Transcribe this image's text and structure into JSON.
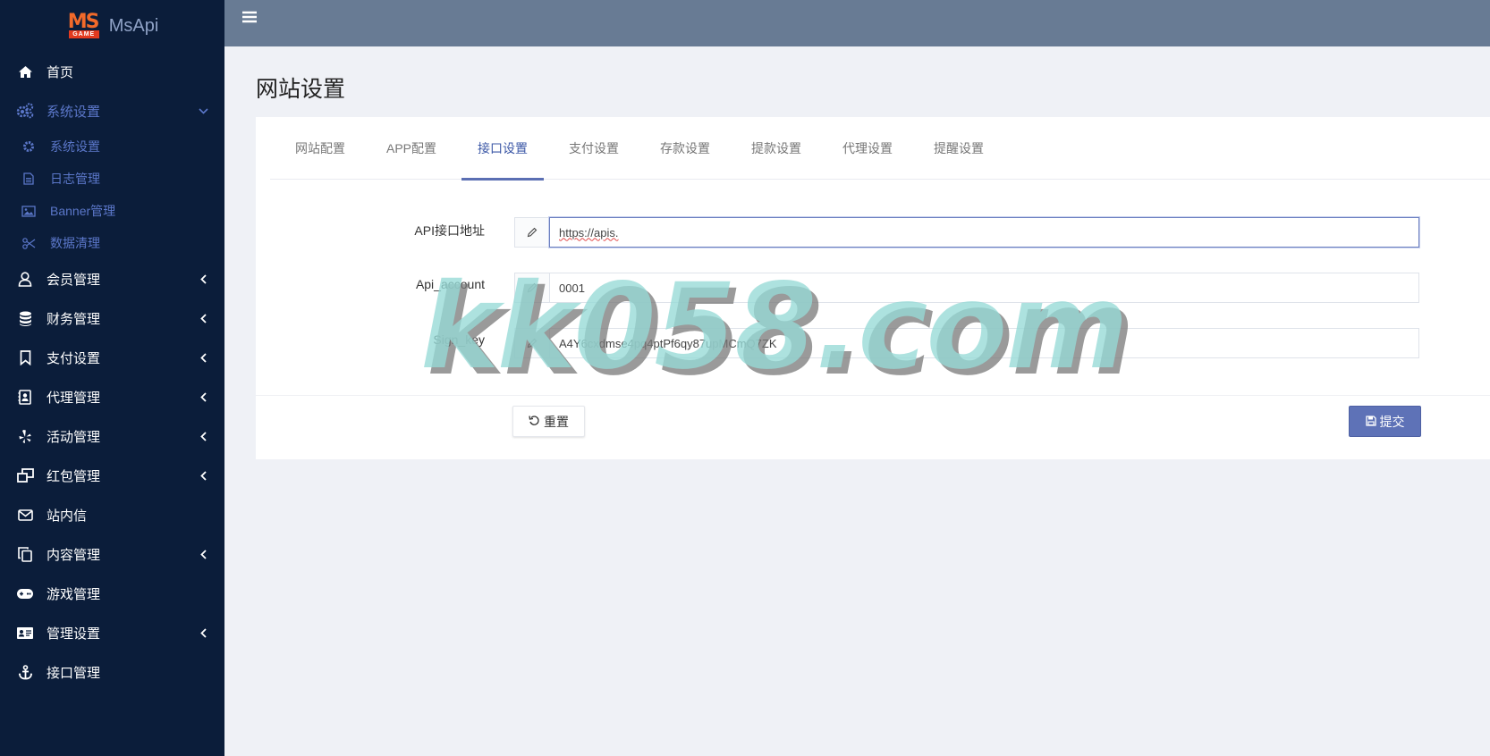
{
  "brand": {
    "logo_text": "MS",
    "logo_sub": "GAME",
    "name": "MsApi"
  },
  "sidebar": {
    "items": [
      {
        "label": "首页",
        "icon": "home-icon"
      },
      {
        "label": "系统设置",
        "icon": "cogs-icon",
        "expanded": true
      },
      {
        "label": "会员管理",
        "icon": "user-icon"
      },
      {
        "label": "财务管理",
        "icon": "database-icon"
      },
      {
        "label": "支付设置",
        "icon": "bookmark-icon"
      },
      {
        "label": "代理管理",
        "icon": "address-book-icon"
      },
      {
        "label": "活动管理",
        "icon": "yelp-icon"
      },
      {
        "label": "红包管理",
        "icon": "window-restore-icon"
      },
      {
        "label": "站内信",
        "icon": "envelope-icon"
      },
      {
        "label": "内容管理",
        "icon": "copy-icon"
      },
      {
        "label": "游戏管理",
        "icon": "gamepad-icon"
      },
      {
        "label": "管理设置",
        "icon": "id-card-icon"
      },
      {
        "label": "接口管理",
        "icon": "anchor-icon"
      }
    ],
    "sub_items": [
      {
        "label": "系统设置",
        "icon": "gear-icon"
      },
      {
        "label": "日志管理",
        "icon": "file-text-icon"
      },
      {
        "label": "Banner管理",
        "icon": "image-icon"
      },
      {
        "label": "数据清理",
        "icon": "scissors-icon"
      }
    ]
  },
  "page": {
    "title": "网站设置"
  },
  "tabs": [
    {
      "label": "网站配置"
    },
    {
      "label": "APP配置"
    },
    {
      "label": "接口设置",
      "active": true
    },
    {
      "label": "支付设置"
    },
    {
      "label": "存款设置"
    },
    {
      "label": "提款设置"
    },
    {
      "label": "代理设置"
    },
    {
      "label": "提醒设置"
    }
  ],
  "form": {
    "fields": [
      {
        "label": "API接口地址",
        "value": "https://apis."
      },
      {
        "label": "Api_account",
        "value": "0001"
      },
      {
        "label": "Sign_key",
        "value": "A4Y6cxdmse4pq4ptPf6qy87upMCmQ7ZK"
      }
    ],
    "reset_label": "重置",
    "submit_label": "提交"
  },
  "watermark": {
    "text": "kk058.com"
  },
  "colors": {
    "sidebar_bg": "#0b1d3a",
    "topbar_bg": "#687b94",
    "accent": "#5e72b7",
    "active_text": "#5b77c9"
  }
}
